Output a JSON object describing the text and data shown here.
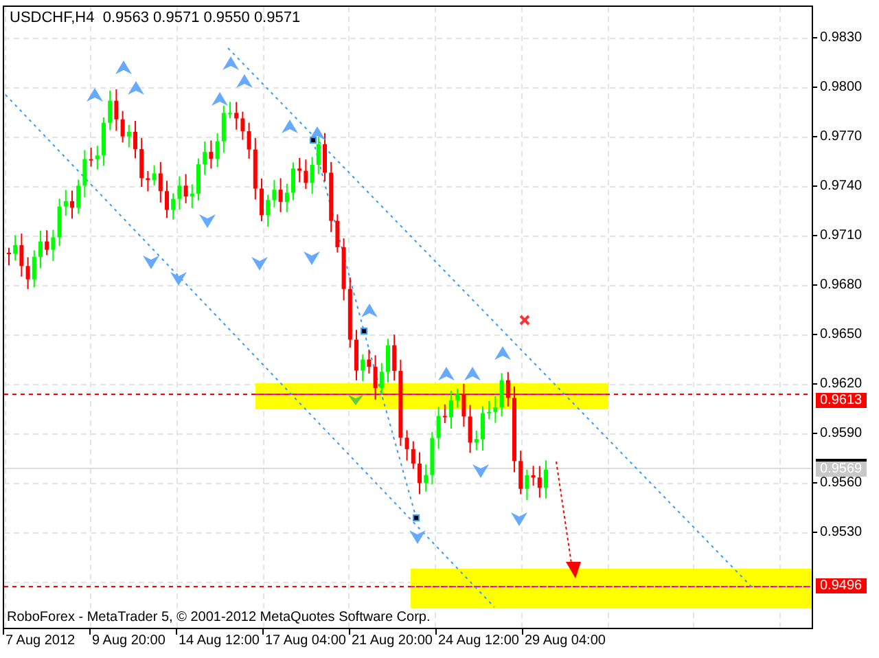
{
  "chart": {
    "header": "USDCHF,H4  0.9563 0.9571 0.9550 0.9571",
    "copyright": "RoboForex - MetaTrader 5, © 2001-2012 MetaQuotes Software Corp.",
    "price_axis": [
      "0.9830",
      "0.9800",
      "0.9770",
      "0.9740",
      "0.9710",
      "0.9680",
      "0.9650",
      "0.9620",
      "0.9590",
      "0.9560",
      "0.9530"
    ],
    "price_markers": [
      {
        "label": "0.9613",
        "kind": "level"
      },
      {
        "label": "0.9569",
        "kind": "current"
      },
      {
        "label": "0.9496",
        "kind": "level"
      }
    ],
    "time_axis": [
      "7 Aug 2012",
      "9 Aug 20:00",
      "14 Aug 12:00",
      "17 Aug 04:00",
      "21 Aug 20:00",
      "24 Aug 12:00",
      "29 Aug 04:00"
    ]
  }
}
